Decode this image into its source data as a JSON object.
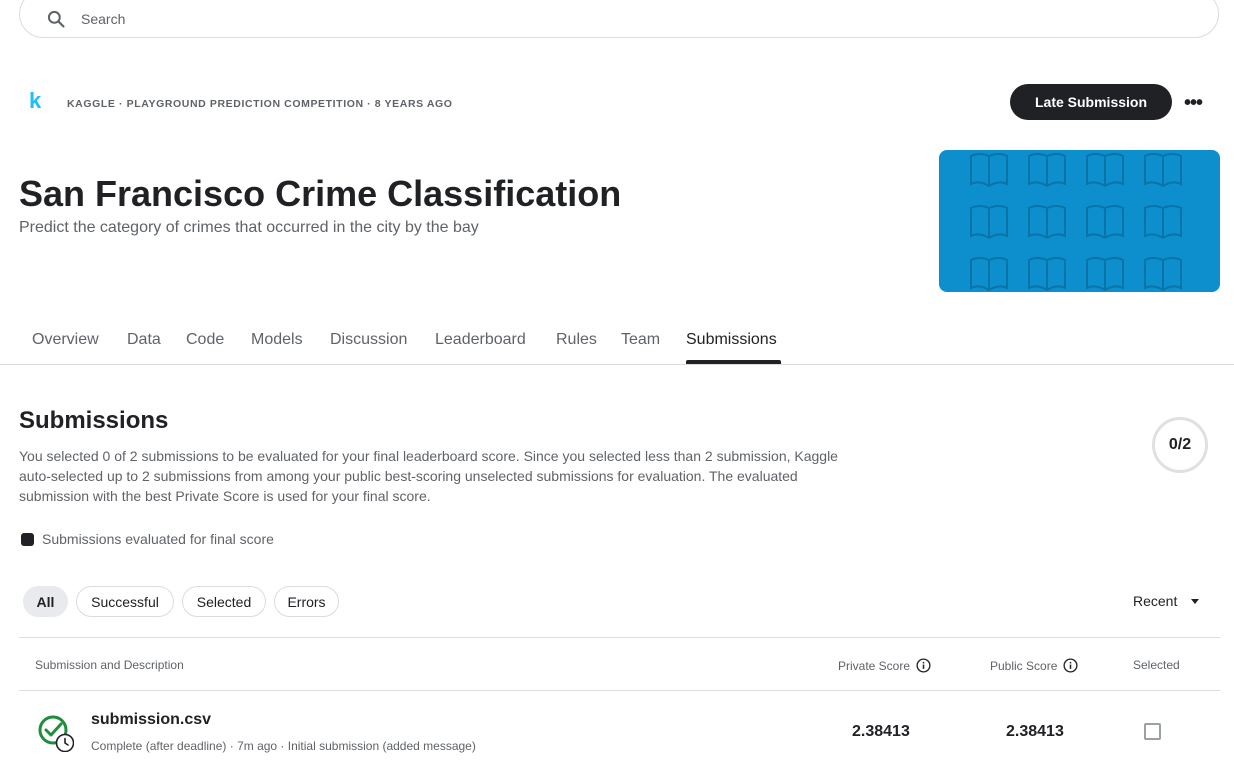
{
  "search": {
    "placeholder": "Search"
  },
  "header": {
    "logo": "k",
    "meta": "KAGGLE · PLAYGROUND PREDICTION COMPETITION · 8 YEARS AGO",
    "late_submission_label": "Late Submission",
    "more_label": "•••"
  },
  "competition": {
    "title": "San Francisco Crime Classification",
    "subtitle": "Predict the category of crimes that occurred in the city by the bay",
    "banner_color": "#0d8fce"
  },
  "tabs": [
    {
      "label": "Overview"
    },
    {
      "label": "Data"
    },
    {
      "label": "Code"
    },
    {
      "label": "Models"
    },
    {
      "label": "Discussion"
    },
    {
      "label": "Leaderboard"
    },
    {
      "label": "Rules"
    },
    {
      "label": "Team"
    },
    {
      "label": "Submissions",
      "active": true
    }
  ],
  "submissions": {
    "title": "Submissions",
    "description": "You selected 0 of 2 submissions to be evaluated for your final leaderboard score. Since you selected less than 2 submission, Kaggle auto-selected up to 2 submissions from among your public best-scoring unselected submissions for evaluation. The evaluated submission with the best Private Score is used for your final score.",
    "counter": "0/2",
    "legend": "Submissions evaluated for final score",
    "filters": [
      {
        "label": "All",
        "active": true
      },
      {
        "label": "Successful"
      },
      {
        "label": "Selected"
      },
      {
        "label": "Errors"
      }
    ],
    "sort": "Recent",
    "columns": {
      "submission": "Submission and Description",
      "private": "Private Score",
      "public": "Public Score",
      "selected": "Selected"
    },
    "rows": [
      {
        "file": "submission.csv",
        "description": "Complete (after deadline) · 7m ago · Initial submission (added message)",
        "private_score": "2.38413",
        "public_score": "2.38413",
        "selected": false
      }
    ]
  },
  "colors": {
    "accent": "#20beff",
    "success": "#1e8e3e",
    "dark": "#202124"
  }
}
